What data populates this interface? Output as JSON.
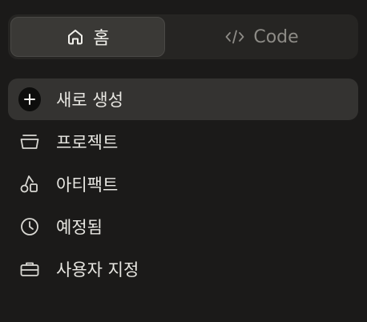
{
  "tabs": {
    "home_label": "홈",
    "code_label": "Code"
  },
  "menu": {
    "items": [
      {
        "label": "새로 생성",
        "icon": "plus-icon"
      },
      {
        "label": "프로젝트",
        "icon": "folder-icon"
      },
      {
        "label": "아티팩트",
        "icon": "shapes-icon"
      },
      {
        "label": "예정됨",
        "icon": "clock-icon"
      },
      {
        "label": "사용자 지정",
        "icon": "briefcase-icon"
      }
    ]
  },
  "colors": {
    "background": "#1b1a19",
    "active_item": "#343331",
    "segment_active": "#3a3936",
    "text": "#e8e7e2",
    "muted": "#8d8b86"
  }
}
